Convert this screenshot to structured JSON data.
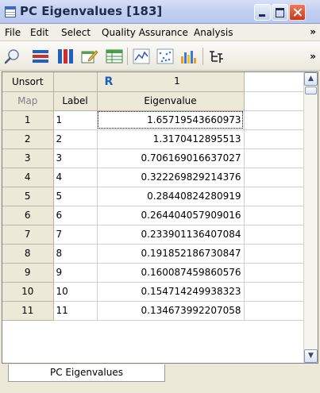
{
  "window": {
    "title": "PC Eigenvalues [183]"
  },
  "menu": [
    "File",
    "Edit",
    "Select",
    "Quality Assurance",
    "Analysis"
  ],
  "menu_overflow": "»",
  "toolbar": {
    "icons": [
      "magnifier-icon",
      "rows-icon",
      "columns-icon",
      "edit-icon",
      "table-icon",
      "line-chart-icon",
      "scatter-icon",
      "bar-chart-icon",
      "tree-icon"
    ],
    "overflow": "»"
  },
  "grid": {
    "sort_label": "Unsort",
    "map_label": "Map",
    "label_header": "Label",
    "r_marker": "R",
    "column_number": "1",
    "value_header": "Eigenvalue",
    "rows": [
      {
        "num": "1",
        "label": "1",
        "value": "1.65719543660973"
      },
      {
        "num": "2",
        "label": "2",
        "value": "1.3170412895513"
      },
      {
        "num": "3",
        "label": "3",
        "value": "0.706169016637027"
      },
      {
        "num": "4",
        "label": "4",
        "value": "0.322269829214376"
      },
      {
        "num": "5",
        "label": "5",
        "value": "0.28440824280919"
      },
      {
        "num": "6",
        "label": "6",
        "value": "0.264404057909016"
      },
      {
        "num": "7",
        "label": "7",
        "value": "0.233901136407084"
      },
      {
        "num": "8",
        "label": "8",
        "value": "0.191852186730847"
      },
      {
        "num": "9",
        "label": "9",
        "value": "0.160087459860576"
      },
      {
        "num": "10",
        "label": "10",
        "value": "0.154714249938323"
      },
      {
        "num": "11",
        "label": "11",
        "value": "0.134673992207058"
      }
    ]
  },
  "tabs": [
    "PC Eigenvalues"
  ]
}
